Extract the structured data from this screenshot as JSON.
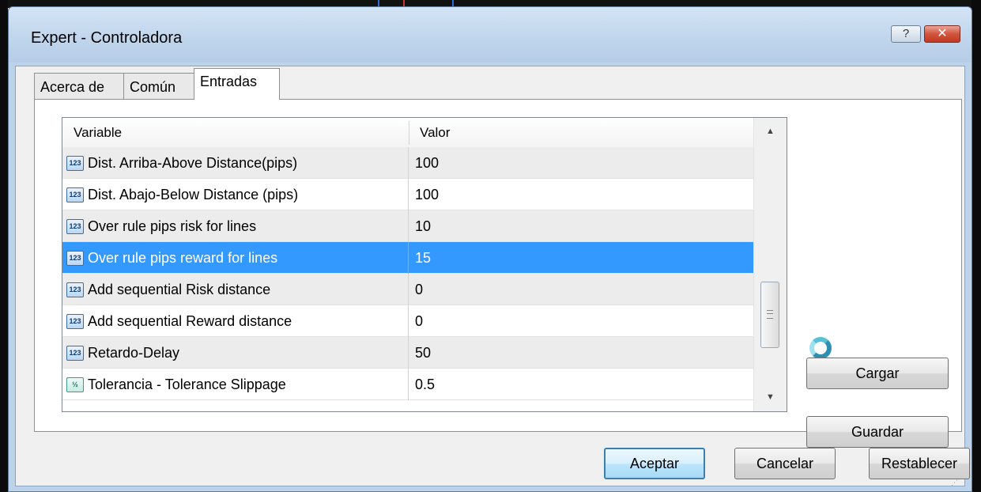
{
  "window": {
    "title": "Expert - Controladora",
    "help_label": "?",
    "close_label": "✕"
  },
  "tabs": [
    {
      "label": "Acerca de"
    },
    {
      "label": "Común"
    },
    {
      "label": "Entradas",
      "active": true
    }
  ],
  "grid": {
    "headers": {
      "variable": "Variable",
      "value": "Valor"
    },
    "rows": [
      {
        "icon": "integer-icon",
        "icon_text": "123",
        "name": "Dist. Arriba-Above Distance(pips)",
        "value": "100"
      },
      {
        "icon": "integer-icon",
        "icon_text": "123",
        "name": "Dist. Abajo-Below Distance (pips)",
        "value": "100"
      },
      {
        "icon": "integer-icon",
        "icon_text": "123",
        "name": "Over rule pips risk for lines",
        "value": "10"
      },
      {
        "icon": "integer-icon",
        "icon_text": "123",
        "name": "Over rule pips reward for lines",
        "value": "15",
        "selected": true
      },
      {
        "icon": "integer-icon",
        "icon_text": "123",
        "name": "Add sequential Risk distance",
        "value": "0"
      },
      {
        "icon": "integer-icon",
        "icon_text": "123",
        "name": "Add sequential Reward distance",
        "value": "0"
      },
      {
        "icon": "integer-icon",
        "icon_text": "123",
        "name": "Retardo-Delay",
        "value": "50"
      },
      {
        "icon": "double-icon",
        "icon_text": "½",
        "name": "Tolerancia - Tolerance Slippage",
        "value": "0.5"
      }
    ],
    "scroll_up": "▲",
    "scroll_down": "▼"
  },
  "side_buttons": {
    "load": "Cargar",
    "save": "Guardar"
  },
  "footer_buttons": {
    "accept": "Aceptar",
    "cancel": "Cancelar",
    "reset": "Restablecer"
  },
  "colors": {
    "selection": "#3399ff",
    "title_bg": "#bfd5ec",
    "close_button": "#c23a22"
  }
}
